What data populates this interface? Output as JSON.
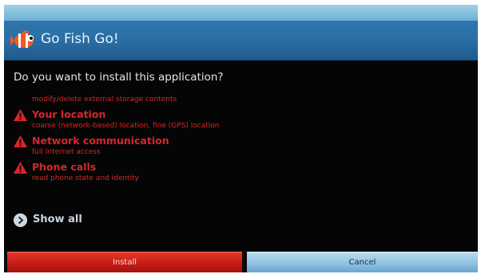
{
  "dialog": {
    "app_title": "Go Fish Go!",
    "question": "Do you want to install this application?",
    "partial_permission": "modify/delete external storage contents",
    "permissions": [
      {
        "title": "Your location",
        "detail": "coarse (network-based) location, fine (GPS) location",
        "icon": "warning-icon"
      },
      {
        "title": "Network communication",
        "detail": "full Internet access",
        "icon": "warning-icon"
      },
      {
        "title": "Phone calls",
        "detail": "read phone state and identity",
        "icon": "warning-icon"
      }
    ],
    "show_all_label": "Show all",
    "install_label": "Install",
    "cancel_label": "Cancel"
  },
  "colors": {
    "titlebar": "#2a6ea5",
    "permission_red": "#d8262a",
    "install_red": "#c61c14",
    "cancel_blue": "#8fc2e2",
    "background": "#050505"
  },
  "icons": {
    "app": "clownfish-icon",
    "warning": "warning-icon",
    "show_all": "chevron-right-icon"
  }
}
